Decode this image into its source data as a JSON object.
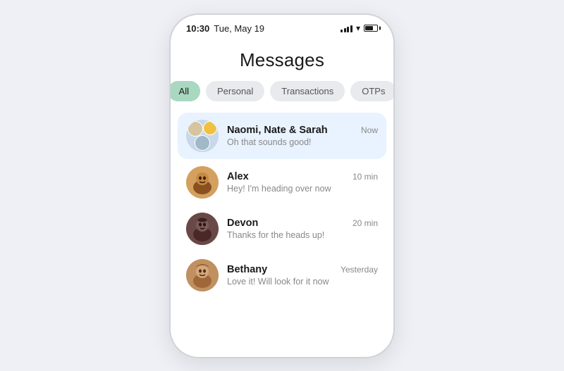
{
  "statusBar": {
    "time": "10:30",
    "date": "Tue, May 19"
  },
  "pageTitle": "Messages",
  "filterTabs": [
    {
      "id": "all",
      "label": "All",
      "active": true
    },
    {
      "id": "personal",
      "label": "Personal",
      "active": false
    },
    {
      "id": "transactions",
      "label": "Transactions",
      "active": false
    },
    {
      "id": "otps",
      "label": "OTPs",
      "active": false
    }
  ],
  "conversations": [
    {
      "id": "naomi-nate-sarah",
      "name": "Naomi, Nate & Sarah",
      "preview": "Oh that sounds good!",
      "time": "Now",
      "avatarType": "group",
      "highlighted": true
    },
    {
      "id": "alex",
      "name": "Alex",
      "preview": "Hey! I'm heading over now",
      "time": "10 min",
      "avatarType": "alex",
      "highlighted": false
    },
    {
      "id": "devon",
      "name": "Devon",
      "preview": "Thanks for the heads up!",
      "time": "20 min",
      "avatarType": "devon",
      "highlighted": false
    },
    {
      "id": "bethany",
      "name": "Bethany",
      "preview": "Love it! Will look for it now",
      "time": "Yesterday",
      "avatarType": "bethany",
      "highlighted": false
    }
  ]
}
